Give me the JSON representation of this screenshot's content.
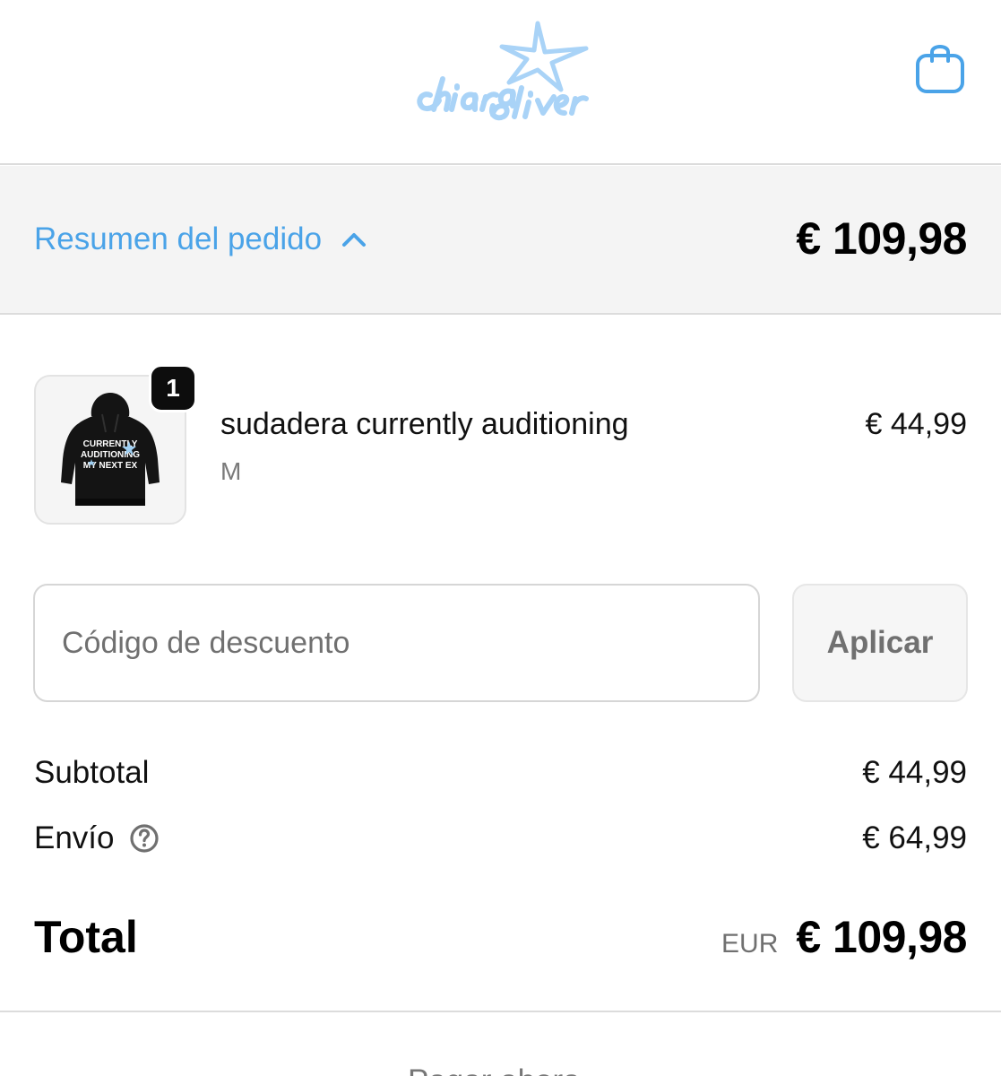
{
  "header": {
    "logo_text": "chiara oliver",
    "cart_icon": "shopping-bag-icon",
    "accent_color": "#a9d3f7"
  },
  "summary": {
    "label": "Resumen del pedido",
    "toggle_icon": "chevron-up-icon",
    "total": "€ 109,98",
    "accent_color": "#4aa3e8"
  },
  "cart": {
    "items": [
      {
        "quantity": "1",
        "name": "sudadera currently auditioning",
        "variant": "M",
        "price": "€ 44,99",
        "print_lines": [
          "CURRENTLY",
          "AUDITIONING",
          "MY NEXT EX"
        ]
      }
    ]
  },
  "discount": {
    "placeholder": "Código de descuento",
    "apply_label": "Aplicar"
  },
  "totals": {
    "subtotal_label": "Subtotal",
    "subtotal_value": "€ 44,99",
    "shipping_label": "Envío",
    "shipping_help_icon": "question-circle-icon",
    "shipping_value": "€ 64,99",
    "total_label": "Total",
    "currency": "EUR",
    "total_value": "€ 109,98"
  },
  "footer": {
    "cutoff_text": "Pagar ahora"
  }
}
